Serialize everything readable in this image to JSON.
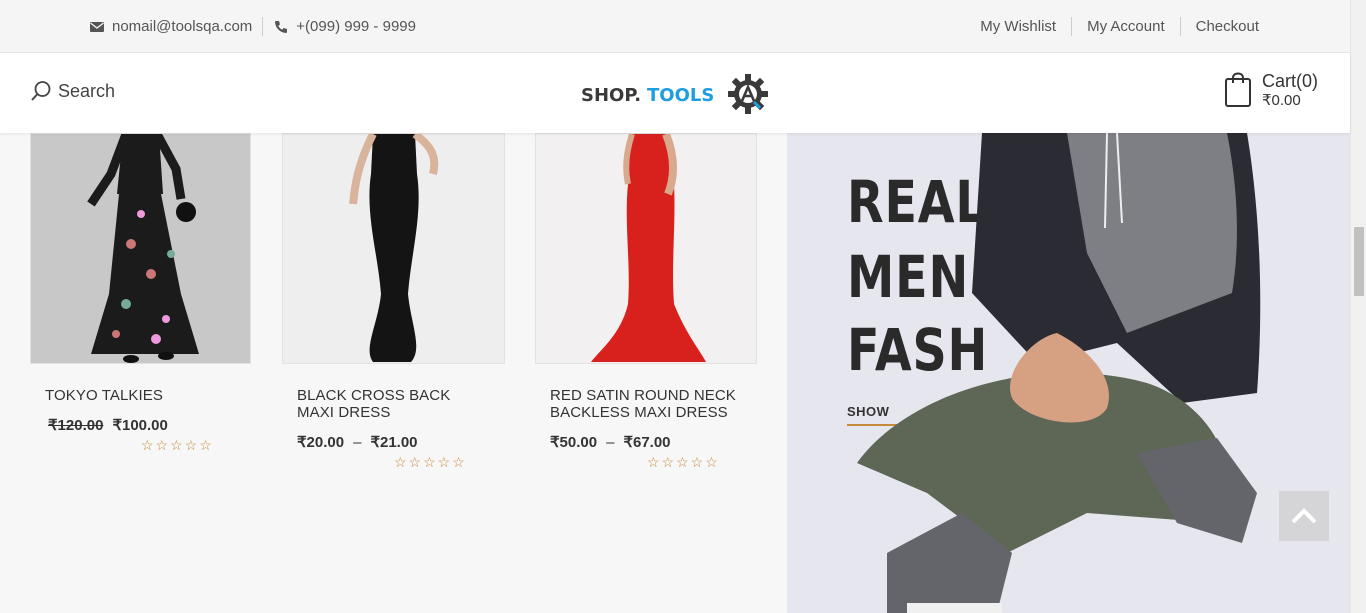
{
  "topbar": {
    "email": "nomail@toolsqa.com",
    "phone": "+(099) 999 - 9999",
    "links": [
      "My Wishlist",
      "My Account",
      "Checkout"
    ]
  },
  "header": {
    "search_label": "Search",
    "logo_text_dark": "SHOP.",
    "logo_text_blue": "TOOLS",
    "cart_label": "Cart(0)",
    "cart_total": "₹0.00"
  },
  "products": [
    {
      "name_line1": "TOKYO TALKIES",
      "name_line2": "",
      "old_price": "₹120.00",
      "price": "₹100.00",
      "stars": "☆☆☆☆☆"
    },
    {
      "name_line1": "BLACK CROSS BACK",
      "name_line2": "MAXI DRESS",
      "price_min": "₹20.00",
      "price_sep": "–",
      "price_max": "₹21.00",
      "stars": "☆☆☆☆☆"
    },
    {
      "name_line1": "RED SATIN ROUND NECK",
      "name_line2": "BACKLESS MAXI DRESS",
      "price_min": "₹50.00",
      "price_sep": "–",
      "price_max": "₹67.00",
      "stars": "☆☆☆☆☆"
    }
  ],
  "banner": {
    "line1": "REAL",
    "line2": "MEN",
    "line3": "FASH",
    "cta": "SHOW"
  },
  "colors": {
    "accent": "#c58a3a",
    "logo_blue": "#1e9ee0",
    "logo_dark": "#3a3a3a"
  },
  "icons": {
    "email": "envelope-icon",
    "phone": "phone-icon",
    "search": "search-icon",
    "cart": "shopping-bag-icon",
    "to_top": "chevron-up-icon"
  }
}
